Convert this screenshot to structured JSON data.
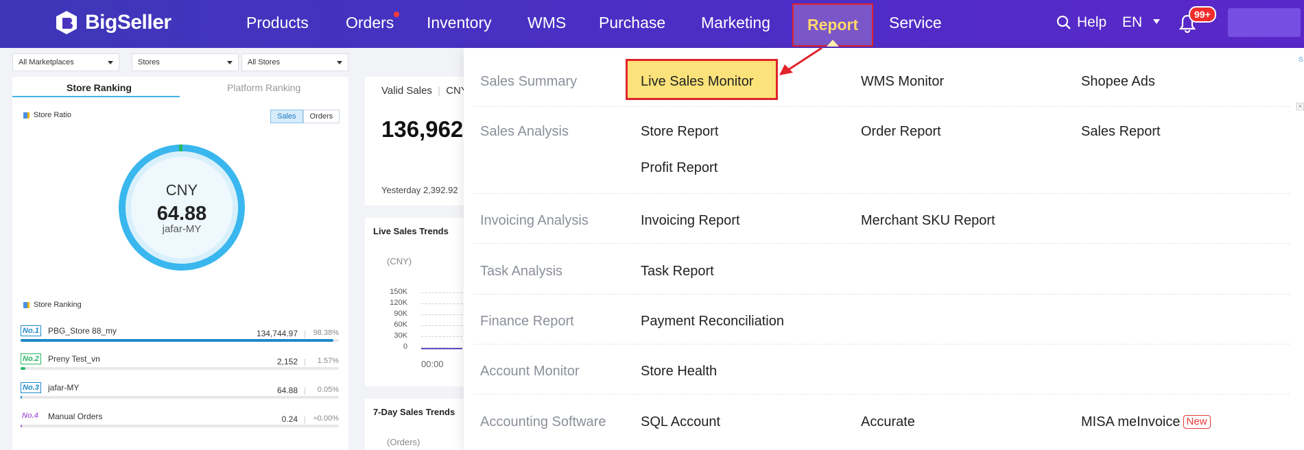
{
  "brand": {
    "name": "BigSeller"
  },
  "nav": {
    "products": "Products",
    "orders": "Orders",
    "inventory": "Inventory",
    "wms": "WMS",
    "purchase": "Purchase",
    "marketing": "Marketing",
    "report": "Report",
    "service": "Service",
    "help": "Help",
    "lang": "EN",
    "notif_count": "99+"
  },
  "filters": {
    "marketplaces": "All Marketplaces",
    "stores": "Stores",
    "all_stores": "All Stores"
  },
  "ranking": {
    "tab_store": "Store Ranking",
    "tab_platform": "Platform Ranking",
    "store_ratio": "Store Ratio",
    "toggle_sales": "Sales",
    "toggle_orders": "Orders",
    "donut_currency": "CNY",
    "donut_value": "64.88",
    "donut_store": "jafar-MY",
    "store_ranking": "Store Ranking",
    "rows": [
      {
        "rank": "No.1",
        "name": "PBG_Store 88_my",
        "amount": "134,744.97",
        "pct": "98.38%",
        "share": 98.38,
        "color": "#1e88c8"
      },
      {
        "rank": "No.2",
        "name": "Preny Test_vn",
        "amount": "2,152",
        "pct": "1.57%",
        "share": 1.57,
        "color": "#29b765"
      },
      {
        "rank": "No.3",
        "name": "jafar-MY",
        "amount": "64.88",
        "pct": "0.05%",
        "share": 0.05,
        "color": "#1e88c8"
      },
      {
        "rank": "No.4",
        "name": "Manual Orders",
        "amount": "0.24",
        "pct": "≈0.00%",
        "share": 0.0,
        "color": "#b06ad8"
      }
    ]
  },
  "summary": {
    "valid_sales_label": "Valid Sales",
    "currency": "CNY",
    "value": "136,962.",
    "yesterday": "Yesterday 2,392.92"
  },
  "trends": {
    "title": "Live Sales Trends",
    "unit": "(CNY)",
    "yticks": [
      "150K",
      "120K",
      "90K",
      "60K",
      "30K",
      "0"
    ],
    "xtick": "00:00"
  },
  "seven_day": {
    "title": "7-Day Sales Trends",
    "unit": "(Orders)"
  },
  "dropdown": {
    "rows": [
      {
        "category": "Sales Summary",
        "links": [
          "Live Sales Monitor",
          "WMS Monitor",
          "Shopee Ads"
        ]
      },
      {
        "category": "Sales Analysis",
        "links": [
          "Store Report",
          "Order Report",
          "Sales Report",
          "Profit Report"
        ]
      },
      {
        "category": "Invoicing Analysis",
        "links": [
          "Invoicing Report",
          "Merchant SKU Report"
        ]
      },
      {
        "category": "Task Analysis",
        "links": [
          "Task Report"
        ]
      },
      {
        "category": "Finance Report",
        "links": [
          "Payment Reconciliation"
        ]
      },
      {
        "category": "Account Monitor",
        "links": [
          "Store Health"
        ]
      },
      {
        "category": "Accounting Software",
        "links": [
          "SQL Account",
          "Accurate",
          "MISA meInvoice"
        ],
        "new_tag": "New"
      }
    ]
  }
}
